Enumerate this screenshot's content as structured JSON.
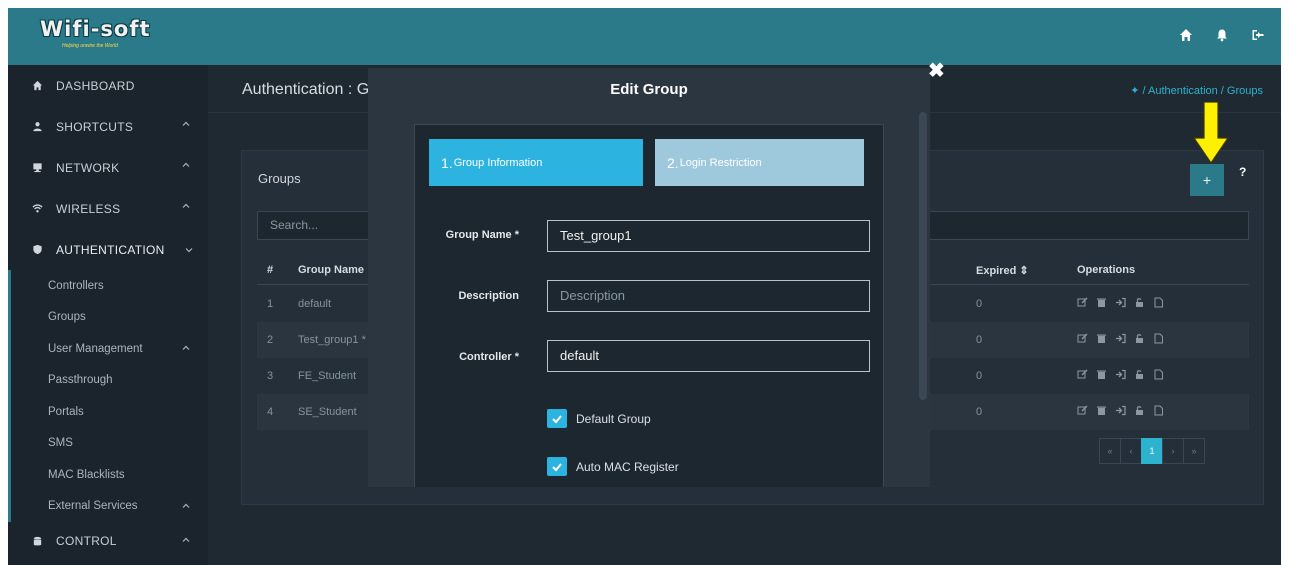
{
  "header": {
    "logo_text": "Wifi-soft",
    "logo_tagline": "Helping unwire the World",
    "icons": [
      "home-icon",
      "bell-icon",
      "logout-icon"
    ]
  },
  "sidebar": {
    "sections": [
      {
        "label": "DASHBOARD",
        "icon": "home-icon"
      },
      {
        "label": "SHORTCUTS",
        "icon": "user-icon"
      },
      {
        "label": "NETWORK",
        "icon": "desktop-icon"
      },
      {
        "label": "WIRELESS",
        "icon": "wifi-icon"
      },
      {
        "label": "AUTHENTICATION",
        "icon": "shield-icon"
      },
      {
        "label": "CONTROL",
        "icon": "database-icon"
      }
    ],
    "auth_items": [
      {
        "label": "Controllers"
      },
      {
        "label": "Groups"
      },
      {
        "label": "User Management"
      },
      {
        "label": "Passthrough"
      },
      {
        "label": "Portals"
      },
      {
        "label": "SMS"
      },
      {
        "label": "MAC Blacklists"
      },
      {
        "label": "External Services"
      }
    ]
  },
  "page": {
    "title": "Authentication : G",
    "breadcrumb": "/ Authentication / Groups"
  },
  "panel": {
    "title": "Groups",
    "add_label": "+",
    "help_label": "?",
    "search_placeholder": "Search...",
    "columns": {
      "num": "#",
      "name": "Group Name",
      "expired": "Expired ⇕",
      "operations": "Operations"
    },
    "rows": [
      {
        "num": "1",
        "name": "default",
        "expired": "0"
      },
      {
        "num": "2",
        "name": "Test_group1 *",
        "expired": "0"
      },
      {
        "num": "3",
        "name": "FE_Student",
        "expired": "0"
      },
      {
        "num": "4",
        "name": "SE_Student",
        "expired": "0"
      }
    ],
    "pagination": {
      "first": "«",
      "prev": "‹",
      "current": "1",
      "next": "›",
      "last": "»"
    }
  },
  "modal": {
    "title": "Edit Group",
    "close": "✖",
    "steps": [
      {
        "num": "1.",
        "label": "Group Information"
      },
      {
        "num": "2.",
        "label": "Login Restriction"
      }
    ],
    "fields": {
      "group_name_label": "Group Name *",
      "group_name_value": "Test_group1",
      "description_label": "Description",
      "description_placeholder": "Description",
      "controller_label": "Controller *",
      "controller_value": "default"
    },
    "checkboxes": [
      {
        "label": "Default Group",
        "checked": true
      },
      {
        "label": "Auto MAC Register",
        "checked": true
      }
    ]
  },
  "colors": {
    "topbar": "#2b7a8a",
    "accent": "#2db3e0",
    "step_inactive": "#9ec8dc",
    "background": "#1f2932",
    "highlight_arrow": "#ffef00"
  }
}
